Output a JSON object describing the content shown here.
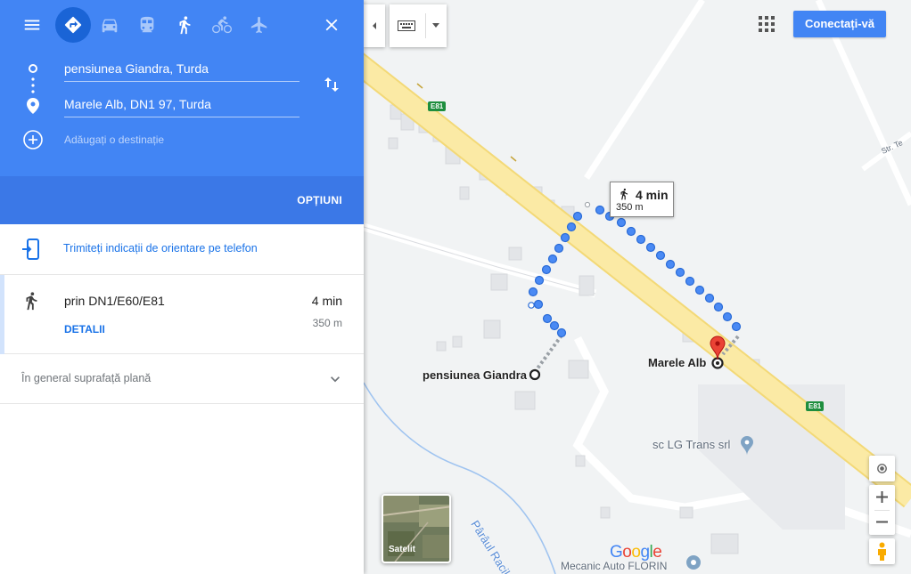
{
  "modes": [
    {
      "name": "menu",
      "icon": "menu-icon"
    },
    {
      "name": "directions",
      "icon": "directions-icon"
    },
    {
      "name": "driving",
      "icon": "car-icon"
    },
    {
      "name": "transit",
      "icon": "train-icon"
    },
    {
      "name": "walking",
      "icon": "walk-icon"
    },
    {
      "name": "cycling",
      "icon": "bicycle-icon"
    },
    {
      "name": "flight",
      "icon": "airplane-icon"
    },
    {
      "name": "close",
      "icon": "close-icon"
    }
  ],
  "route": {
    "origin": "pensiunea Giandra, Turda",
    "destination": "Marele Alb, DN1 97, Turda",
    "add_destination_placeholder": "Adăugați o destinație",
    "options_label": "OPȚIUNI"
  },
  "send_to_phone": "Trimiteți indicații de orientare pe telefon",
  "route_option": {
    "via": "prin DN1/E60/E81",
    "time": "4 min",
    "distance": "350 m",
    "details_label": "DETALII"
  },
  "terrain_note": "În general suprafață plană",
  "map": {
    "signin_label": "Conectați-vă",
    "walk_time": "4 min",
    "walk_distance": "350 m",
    "origin_label": "pensiunea Giandra",
    "destination_label": "Marele Alb",
    "poi_lg": "sc LG Trans srl",
    "poi_mecanic": "Mecanic Auto FLORIN",
    "street_label": "Str. Te",
    "stream_label": "Pârâul Racilor",
    "road_shield_1": "E81",
    "road_shield_2": "E81",
    "satellite_label": "Satelit",
    "google_logo": "Google"
  },
  "colors": {
    "primary": "#4285f4",
    "route_dots": "#4a8af4",
    "road": "#f8e9a0",
    "pin": "#ea4335"
  }
}
